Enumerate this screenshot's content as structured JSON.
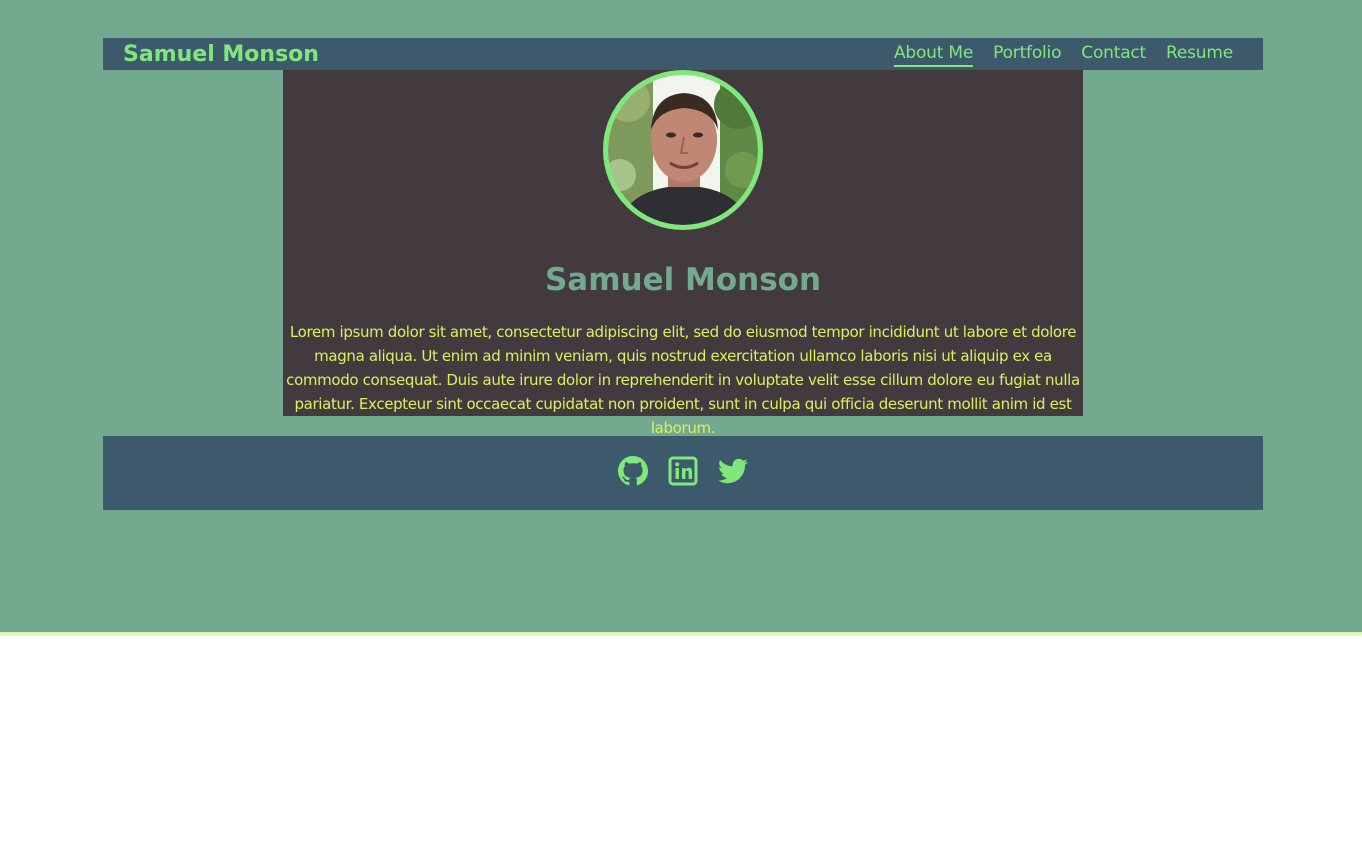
{
  "header": {
    "brand": "Samuel Monson",
    "nav": [
      {
        "label": "About Me",
        "active": true
      },
      {
        "label": "Portfolio",
        "active": false
      },
      {
        "label": "Contact",
        "active": false
      },
      {
        "label": "Resume",
        "active": false
      }
    ]
  },
  "profile": {
    "name": "Samuel Monson",
    "bio": "Lorem ipsum dolor sit amet, consectetur adipiscing elit, sed do eiusmod tempor incididunt ut labore et dolore magna aliqua. Ut enim ad minim veniam, quis nostrud exercitation ullamco laboris nisi ut aliquip ex ea commodo consequat. Duis aute irure dolor in reprehenderit in voluptate velit esse cillum dolore eu fugiat nulla pariatur. Excepteur sint occaecat cupidatat non proident, sunt in culpa qui officia deserunt mollit anim id est laborum."
  },
  "footer": {
    "social": [
      {
        "icon": "github-icon"
      },
      {
        "icon": "linkedin-icon"
      },
      {
        "icon": "twitter-icon"
      }
    ]
  },
  "colors": {
    "page_background": "#73a98e",
    "bar_background": "#3d5a6c",
    "card_background": "#433a3f",
    "accent_green": "#7fe87a",
    "bio_text": "#d7f35a",
    "heading_text": "#73a98e"
  }
}
